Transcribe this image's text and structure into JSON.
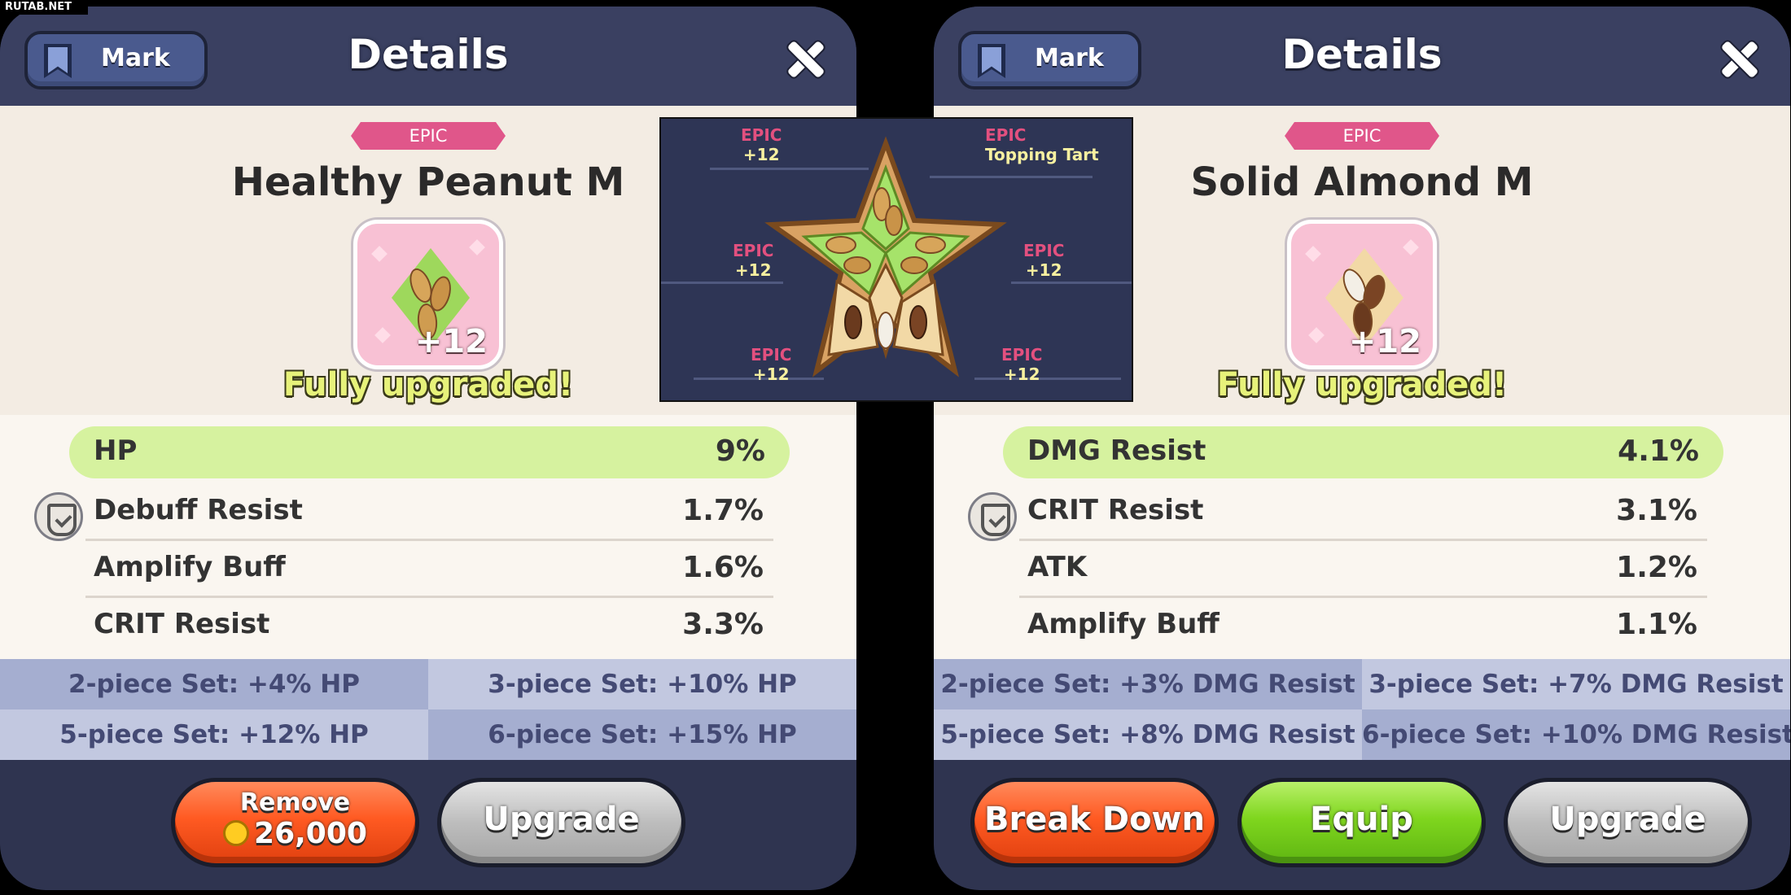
{
  "watermark": "RUTAB.NET",
  "colors": {
    "panel_bg": "#2f3450",
    "epic_badge": "#e0568a",
    "main_stat_highlight": "#d6f29f",
    "fully_upgraded_text": "#e7f27a",
    "remove_button": "#ff5a22",
    "equip_button": "#7fd61e",
    "upgrade_button": "#bdbdbd"
  },
  "left_panel": {
    "mark_label": "Mark",
    "title": "Details",
    "rarity": "EPIC",
    "item_name": "Healthy Peanut M",
    "item_level": "+12",
    "status": "Fully upgraded!",
    "main_stat": {
      "name": "HP",
      "value": "9%"
    },
    "substats": [
      {
        "name": "Debuff Resist",
        "value": "1.7%"
      },
      {
        "name": "Amplify Buff",
        "value": "1.6%"
      },
      {
        "name": "CRIT Resist",
        "value": "3.3%"
      }
    ],
    "set_bonuses": [
      "2-piece Set: +4% HP",
      "3-piece Set: +10% HP",
      "5-piece Set: +12% HP",
      "6-piece Set: +15% HP"
    ],
    "buttons": {
      "remove_label": "Remove",
      "remove_cost": "26,000",
      "upgrade_label": "Upgrade"
    }
  },
  "set_preview": {
    "slots": [
      {
        "rarity": "EPIC",
        "level": "+12"
      },
      {
        "rarity": "EPIC",
        "level": "Topping Tart"
      },
      {
        "rarity": "EPIC",
        "level": "+12"
      },
      {
        "rarity": "EPIC",
        "level": "+12"
      },
      {
        "rarity": "EPIC",
        "level": "+12"
      },
      {
        "rarity": "EPIC",
        "level": "+12"
      }
    ]
  },
  "right_panel": {
    "mark_label": "Mark",
    "title": "Details",
    "rarity": "EPIC",
    "item_name": "Solid Almond M",
    "item_level": "+12",
    "status": "Fully upgraded!",
    "main_stat": {
      "name": "DMG Resist",
      "value": "4.1%"
    },
    "substats": [
      {
        "name": "CRIT Resist",
        "value": "3.1%"
      },
      {
        "name": "ATK",
        "value": "1.2%"
      },
      {
        "name": "Amplify Buff",
        "value": "1.1%"
      }
    ],
    "set_bonuses": [
      "2-piece Set: +3% DMG Resist",
      "3-piece Set: +7% DMG Resist",
      "5-piece Set: +8% DMG Resist",
      "6-piece Set: +10% DMG Resist"
    ],
    "buttons": {
      "break_down_label": "Break Down",
      "equip_label": "Equip",
      "upgrade_label": "Upgrade"
    }
  }
}
